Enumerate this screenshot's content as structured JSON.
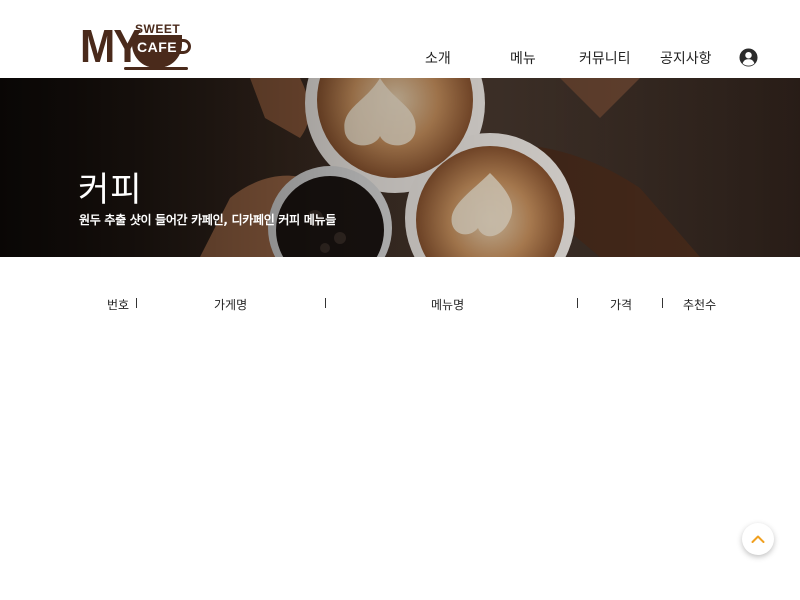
{
  "logo": {
    "main": "MY",
    "sweet": "SWEET",
    "cafe": "CAFE"
  },
  "nav": {
    "items": [
      {
        "label": "소개"
      },
      {
        "label": "메뉴"
      },
      {
        "label": "커뮤니티"
      },
      {
        "label": "공지사항"
      }
    ],
    "user_icon": "user-circle-icon"
  },
  "banner": {
    "title": "커피",
    "subtitle": "원두 추출 샷이 들어간 카페인, 디카페인 커피 메뉴들"
  },
  "table": {
    "columns": [
      "번호",
      "가게명",
      "메뉴명",
      "가격",
      "추천수"
    ],
    "separator": "|",
    "rows": []
  },
  "scroll_top": {
    "icon": "chevron-up-icon",
    "color": "#f0a020"
  },
  "colors": {
    "brand": "#4a2a1b",
    "accent": "#f0a020"
  }
}
